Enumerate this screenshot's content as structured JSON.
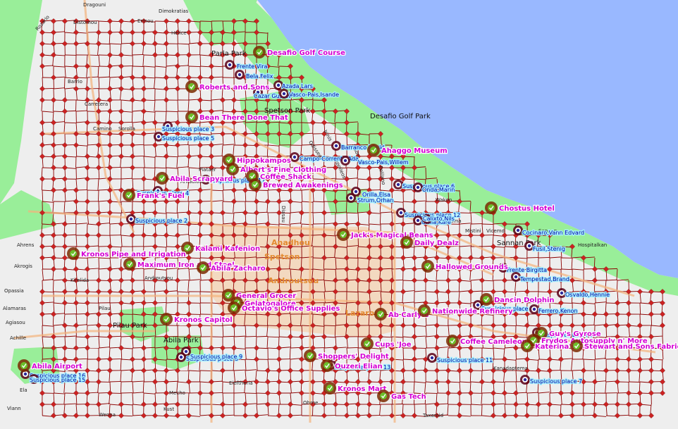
{
  "colors": {
    "water": "#99b8ff",
    "park": "#99ee99",
    "land": "#eeeeee",
    "road": "#8b0000",
    "node": "#cc2222",
    "district_fill": "#f7c99a",
    "poi_text": "#d400d4",
    "suspicious_text": "#0000a0",
    "suspicious_box": "#a6f0ff",
    "poi_marker": "#6bbf2a"
  },
  "parks": [
    {
      "label": "Desafio Golf Park"
    },
    {
      "label": "Spetson Park"
    },
    {
      "label": "Pilau Park"
    },
    {
      "label": "Abila Park"
    },
    {
      "label": "Parla Park"
    },
    {
      "label": "Sannan Park"
    }
  ],
  "districts": [
    "Anadhou",
    "Spetson",
    "Androutsou",
    "Lazarou"
  ],
  "streets": [
    "Dragouni",
    "Rozario",
    "Distomou",
    "Dimokratias",
    "Ermou",
    "Helice",
    "Carretera",
    "Camino",
    "Barrio",
    "Sorolla",
    "Pilau",
    "Mecho",
    "Kust",
    "Wenna",
    "Ahrens",
    "Akrogis",
    "Alamaras",
    "Agiasou",
    "Opassia",
    "Achille",
    "Ela",
    "Viann",
    "Eleftheria",
    "Androutsou",
    "Plataer",
    "Odisseos",
    "Irinis",
    "Jason",
    "Tripolleos",
    "Pelilano",
    "Kirelida",
    "Diasau",
    "Arkadiou",
    "Parla",
    "Kallis",
    "Wakon",
    "Noma",
    "Mistini",
    "Sannan",
    "Hospitalkan",
    "Taxamid",
    "Ohrne",
    "Vicemd",
    "Kanadaptema"
  ],
  "poi": [
    {
      "label": "Desafio Golf Course"
    },
    {
      "label": "Roberts and Sons"
    },
    {
      "label": "Bean There Done That"
    },
    {
      "label": "Hippokampos"
    },
    {
      "label": "Abila Scrapyard"
    },
    {
      "label": "Frank's Fuel"
    },
    {
      "label": "Albert's Fine Clothing"
    },
    {
      "label": "Coffee Shack"
    },
    {
      "label": "Brewed Awakenings"
    },
    {
      "label": "Ahaggo Museum"
    },
    {
      "label": "Chostus Hotel"
    },
    {
      "label": "Jack's Magical Beans"
    },
    {
      "label": "Daily Dealz"
    },
    {
      "label": "Kalami Kafenion"
    },
    {
      "label": "Kronos Pipe and Irrigation"
    },
    {
      "label": "Maximum Iron and Steel"
    },
    {
      "label": "Abila Zacharo"
    },
    {
      "label": "Hallowed Grounds"
    },
    {
      "label": "General Grocer"
    },
    {
      "label": "Gelatogalore"
    },
    {
      "label": "Octavio's Office Supplies"
    },
    {
      "label": "Ab Carlyle"
    },
    {
      "label": "Nationwide Refinery"
    },
    {
      "label": "Dancin Dolphin"
    },
    {
      "label": "Kronos Capitol"
    },
    {
      "label": "Coffee Cameleon"
    },
    {
      "label": "Guy's Gyrose"
    },
    {
      "label": "Frydos Autosupply n' More"
    },
    {
      "label": "Katerina's Cafe"
    },
    {
      "label": "Stewart and Sons Fabrication"
    },
    {
      "label": "Cups 'Joe"
    },
    {
      "label": "Shoppers' Delight"
    },
    {
      "label": "Ouzeri Elian"
    },
    {
      "label": "Kronos Mart"
    },
    {
      "label": "Gas Tech"
    },
    {
      "label": "Abila Airport"
    }
  ],
  "suspicious": [
    {
      "label": "Frente Vira"
    },
    {
      "label": "Bela Felix"
    },
    {
      "label": "Azada Lars"
    },
    {
      "label": "Cazar Gustav"
    },
    {
      "label": "Vasco-Pais,Isande"
    },
    {
      "label": "Suspicious place 3"
    },
    {
      "label": "Suspicious place 5"
    },
    {
      "label": "Barranco Ingrid"
    },
    {
      "label": "Campo-Corrente,Ada"
    },
    {
      "label": "Vasco-Pais,Willem"
    },
    {
      "label": "Suspicious place 17"
    },
    {
      "label": "Suspicious place 4"
    },
    {
      "label": "Orilla,Elsa"
    },
    {
      "label": "Strum,Orhan"
    },
    {
      "label": "Suspicious place 6"
    },
    {
      "label": "Onda,Marin"
    },
    {
      "label": "Suspicious place 2"
    },
    {
      "label": "Suspicious place 12"
    },
    {
      "label": "Orilla,Kare"
    },
    {
      "label": "Calixto,Nils"
    },
    {
      "label": "Cocinaro,Vann Edvard"
    },
    {
      "label": "Fusil,Stenig"
    },
    {
      "label": "Frente Birgitta"
    },
    {
      "label": "Tempestad,Brand"
    },
    {
      "label": "Osvaldo,Hennie"
    },
    {
      "label": "Suspicious place 1"
    },
    {
      "label": "Ferrero,Kenon"
    },
    {
      "label": "Suspicious place 8"
    },
    {
      "label": "Suspicious place 9"
    },
    {
      "label": "Suspicious place 11"
    },
    {
      "label": "Suspicious place 14"
    },
    {
      "label": "Suspicious place 13"
    },
    {
      "label": "Suspicious place 16"
    },
    {
      "label": "Suspicious place 15"
    },
    {
      "label": "Suspicious place 7"
    }
  ]
}
